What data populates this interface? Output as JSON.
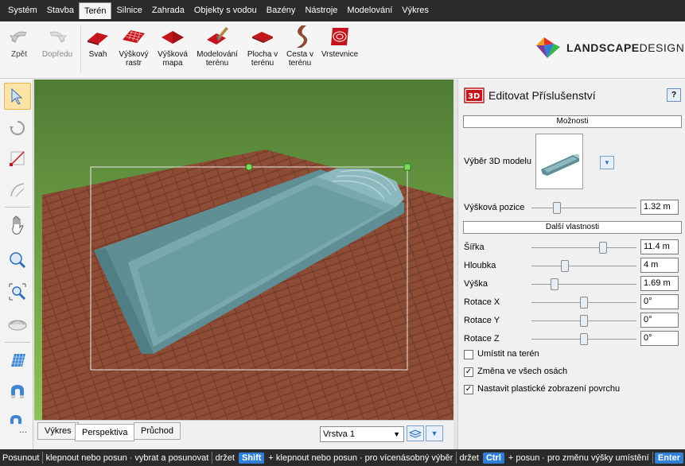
{
  "menu": [
    "Systém",
    "Stavba",
    "Terén",
    "Silnice",
    "Zahrada",
    "Objekty s vodou",
    "Bazény",
    "Nástroje",
    "Modelování",
    "Výkres"
  ],
  "menu_active": "Terén",
  "ribbon": {
    "undo": "Zpět",
    "redo": "Dopředu",
    "slope": [
      "Svah"
    ],
    "height_raster": [
      "Výškový",
      "rastr"
    ],
    "height_map": [
      "Výšková",
      "mapa"
    ],
    "terrain_modeling": [
      "Modelování",
      "terénu"
    ],
    "terrain_area": [
      "Plocha v",
      "terénu"
    ],
    "terrain_path": [
      "Cesta v",
      "terénu"
    ],
    "contours": [
      "Vrstevnice"
    ]
  },
  "logo": {
    "bold": "LANDSCAPE",
    "light": "DESIGNER"
  },
  "view_tabs": [
    "Výkres",
    "Perspektiva",
    "Průchod"
  ],
  "active_view_tab": "Perspektiva",
  "layer": "Vrstva 1",
  "panel": {
    "title": "Editovat Příslušenství",
    "help": "?",
    "options_header": "Možnosti",
    "model_label": "Výběr 3D modelu",
    "height_pos_label": "Výšková pozice",
    "height_pos_value": "1.32 m",
    "more_header": "Další vlastnosti",
    "props": [
      {
        "label": "Šířka",
        "value": "11.4 m",
        "pos": 0.68
      },
      {
        "label": "Hloubka",
        "value": "4 m",
        "pos": 0.32
      },
      {
        "label": "Výška",
        "value": "1.69 m",
        "pos": 0.22
      },
      {
        "label": "Rotace X",
        "value": "0°",
        "pos": 0.5
      },
      {
        "label": "Rotace Y",
        "value": "0°",
        "pos": 0.5
      },
      {
        "label": "Rotace Z",
        "value": "0°",
        "pos": 0.5
      }
    ],
    "height_pos_fraction": 0.24,
    "checkboxes": [
      {
        "label": "Umístit na terén",
        "checked": false
      },
      {
        "label": "Změna ve všech osách",
        "checked": true
      },
      {
        "label": "Nastavit plastické zobrazení povrchu",
        "checked": true
      }
    ]
  },
  "status": {
    "move": "Posunout",
    "click_drag": "klepnout nebo posun",
    "select_move": "vybrat a posunovat",
    "hold": "držet",
    "shift": "Shift",
    "plus_click_drag": "+ klepnout nebo posun",
    "multi_select": "pro vícenásobný výběr",
    "hold2": "držet",
    "ctrl": "Ctrl",
    "plus_drag": "+ posun",
    "height_change": "pro změnu výšky umístění",
    "enter": "Enter"
  },
  "colors": {
    "grass": "#7cb34a",
    "deck": "#8a4a33",
    "pool": "#6f9ea3",
    "accent": "#2f7fd6"
  }
}
